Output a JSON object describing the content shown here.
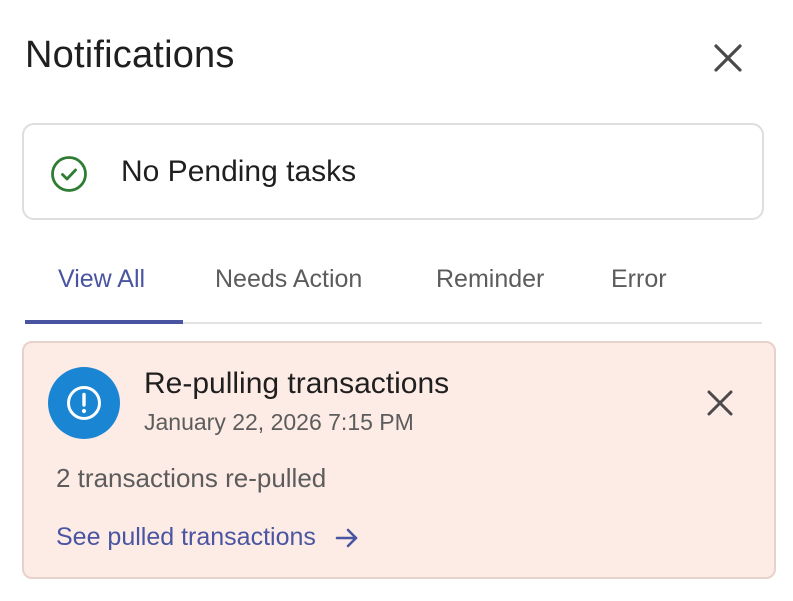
{
  "header": {
    "title": "Notifications",
    "close_icon": "close-icon"
  },
  "pending": {
    "icon": "check-circle-icon",
    "text": "No Pending tasks",
    "icon_color": "#2e7d32"
  },
  "tabs": [
    {
      "label": "View All",
      "active": true
    },
    {
      "label": "Needs Action",
      "active": false
    },
    {
      "label": "Reminder",
      "active": false
    },
    {
      "label": "Error",
      "active": false
    }
  ],
  "notification": {
    "icon": "exclamation-circle-icon",
    "title": "Re-pulling transactions",
    "timestamp": "January 22, 2026 7:15 PM",
    "body": "2 transactions re-pulled",
    "link_label": "See pulled transactions",
    "link_icon": "arrow-right-icon",
    "background_color": "#fdebe5",
    "icon_color": "#1a86d3"
  },
  "colors": {
    "accent": "#4a55a2"
  }
}
